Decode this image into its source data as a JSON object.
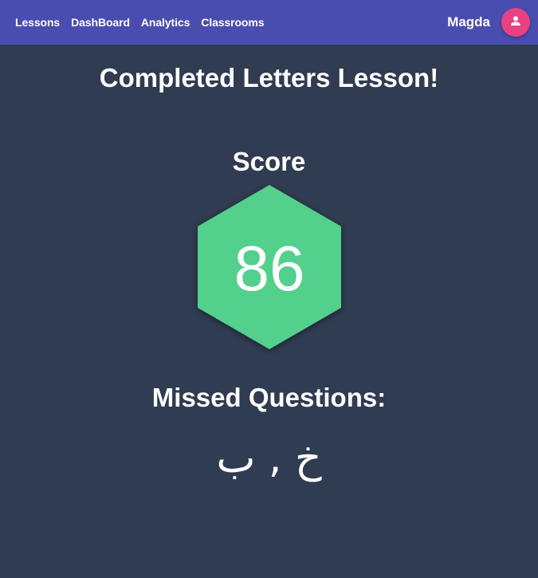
{
  "nav": {
    "links": [
      "Lessons",
      "DashBoard",
      "Analytics",
      "Classrooms"
    ],
    "username": "Magda",
    "avatar_icon": "person-icon"
  },
  "main": {
    "title": "Completed Letters Lesson!",
    "score_label": "Score",
    "score": "86",
    "missed_label": "Missed Questions:",
    "missed_letters": "خ , ب"
  },
  "colors": {
    "navbar": "#4a4db0",
    "background": "#2f3c51",
    "hexagon": "#52d08c",
    "avatar": "#e94181"
  }
}
